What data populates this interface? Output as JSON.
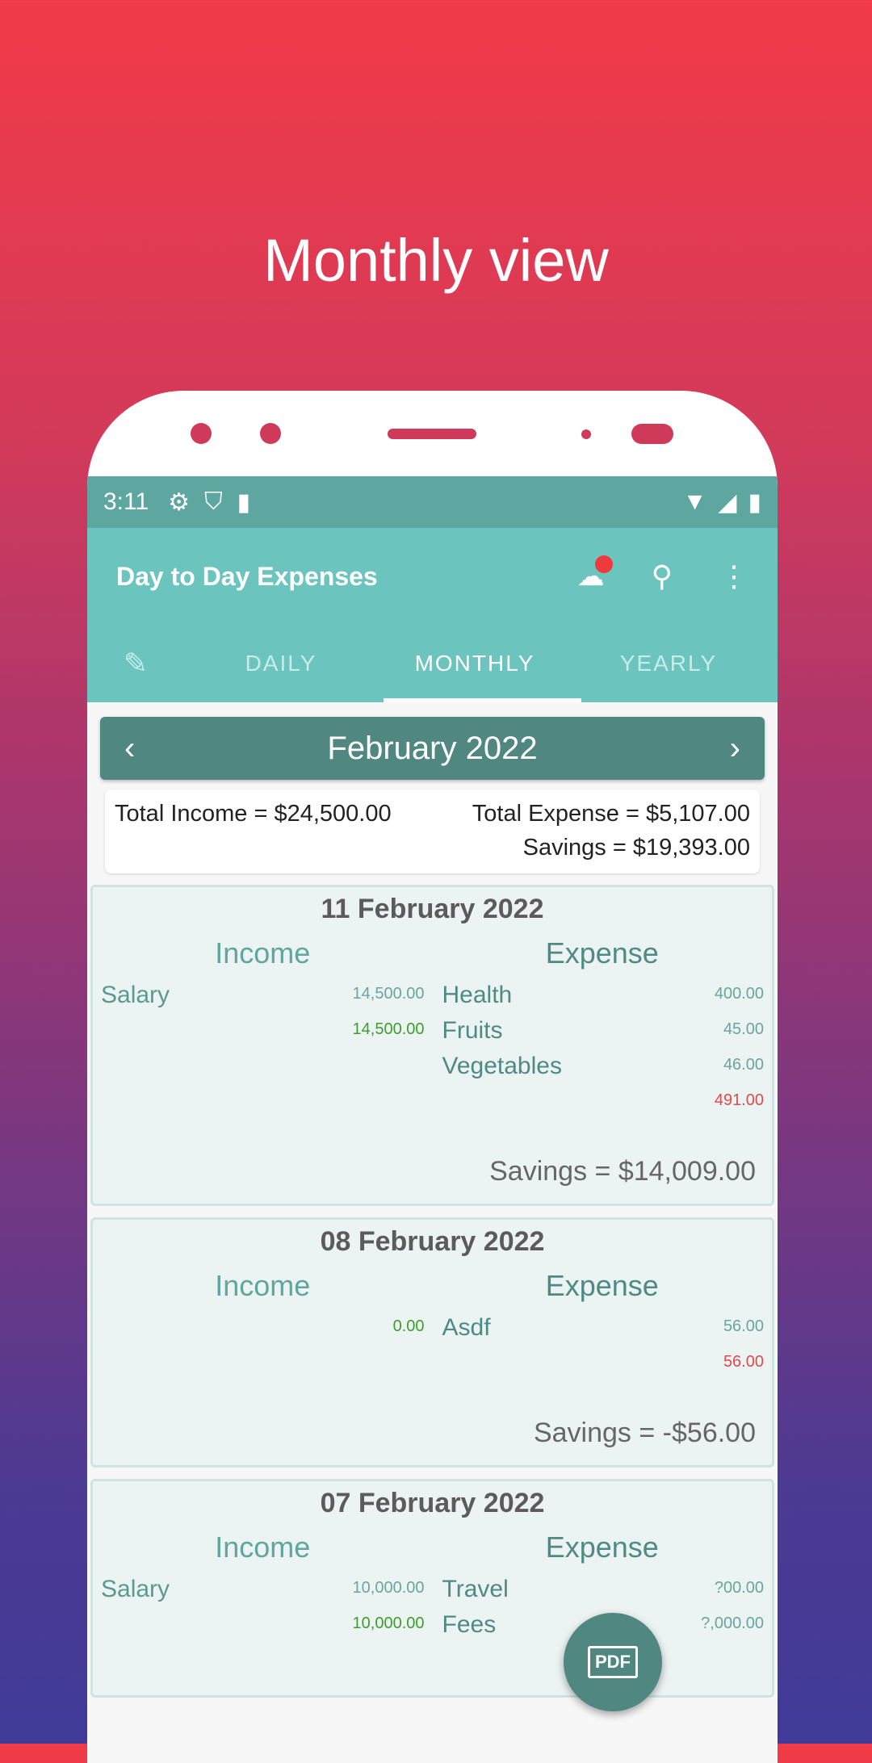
{
  "headline": "Monthly view",
  "status_bar": {
    "time": "3:11",
    "left_icons": [
      "gear-icon",
      "shield-play-icon",
      "sd-card-icon"
    ],
    "right_icons": [
      "wifi-icon",
      "signal-icon",
      "battery-icon"
    ]
  },
  "app_bar": {
    "title": "Day to Day Expenses",
    "actions": [
      "cloud-upload-icon",
      "search-icon",
      "more-vert-icon"
    ]
  },
  "tabs": [
    {
      "label": "DAILY"
    },
    {
      "label": "MONTHLY",
      "active": true
    },
    {
      "label": "YEARLY"
    }
  ],
  "month_nav": {
    "label": "February 2022",
    "prev": "‹",
    "next": "›"
  },
  "totals": {
    "income": "Total Income = $24,500.00",
    "expense": "Total Expense = $5,107.00",
    "savings": "Savings = $19,393.00"
  },
  "colors": {
    "primary": "#6cc4bf",
    "dark": "#508780",
    "income_total": "#3f9d2e",
    "expense_total": "#e04a4a"
  },
  "days": [
    {
      "date": "11 February 2022",
      "income_header": "Income",
      "expense_header": "Expense",
      "income": [
        {
          "name": "Salary",
          "amount": "14,500.00"
        }
      ],
      "income_total": "14,500.00",
      "expense": [
        {
          "name": "Health",
          "amount": "400.00"
        },
        {
          "name": "Fruits",
          "amount": "45.00"
        },
        {
          "name": "Vegetables",
          "amount": "46.00"
        }
      ],
      "expense_total": "491.00",
      "savings": "Savings = $14,009.00"
    },
    {
      "date": "08 February 2022",
      "income_header": "Income",
      "expense_header": "Expense",
      "income": [],
      "income_total": "0.00",
      "expense": [
        {
          "name": "Asdf",
          "amount": "56.00"
        }
      ],
      "expense_total": "56.00",
      "savings": "Savings = -$56.00"
    },
    {
      "date": "07 February 2022",
      "income_header": "Income",
      "expense_header": "Expense",
      "income": [
        {
          "name": "Salary",
          "amount": "10,000.00"
        }
      ],
      "income_total": "10,000.00",
      "expense": [
        {
          "name": "Travel",
          "amount": "?00.00"
        },
        {
          "name": "Fees",
          "amount": "?,000.00"
        }
      ],
      "expense_total": "",
      "savings": ""
    }
  ],
  "fab": {
    "label": "PDF"
  }
}
